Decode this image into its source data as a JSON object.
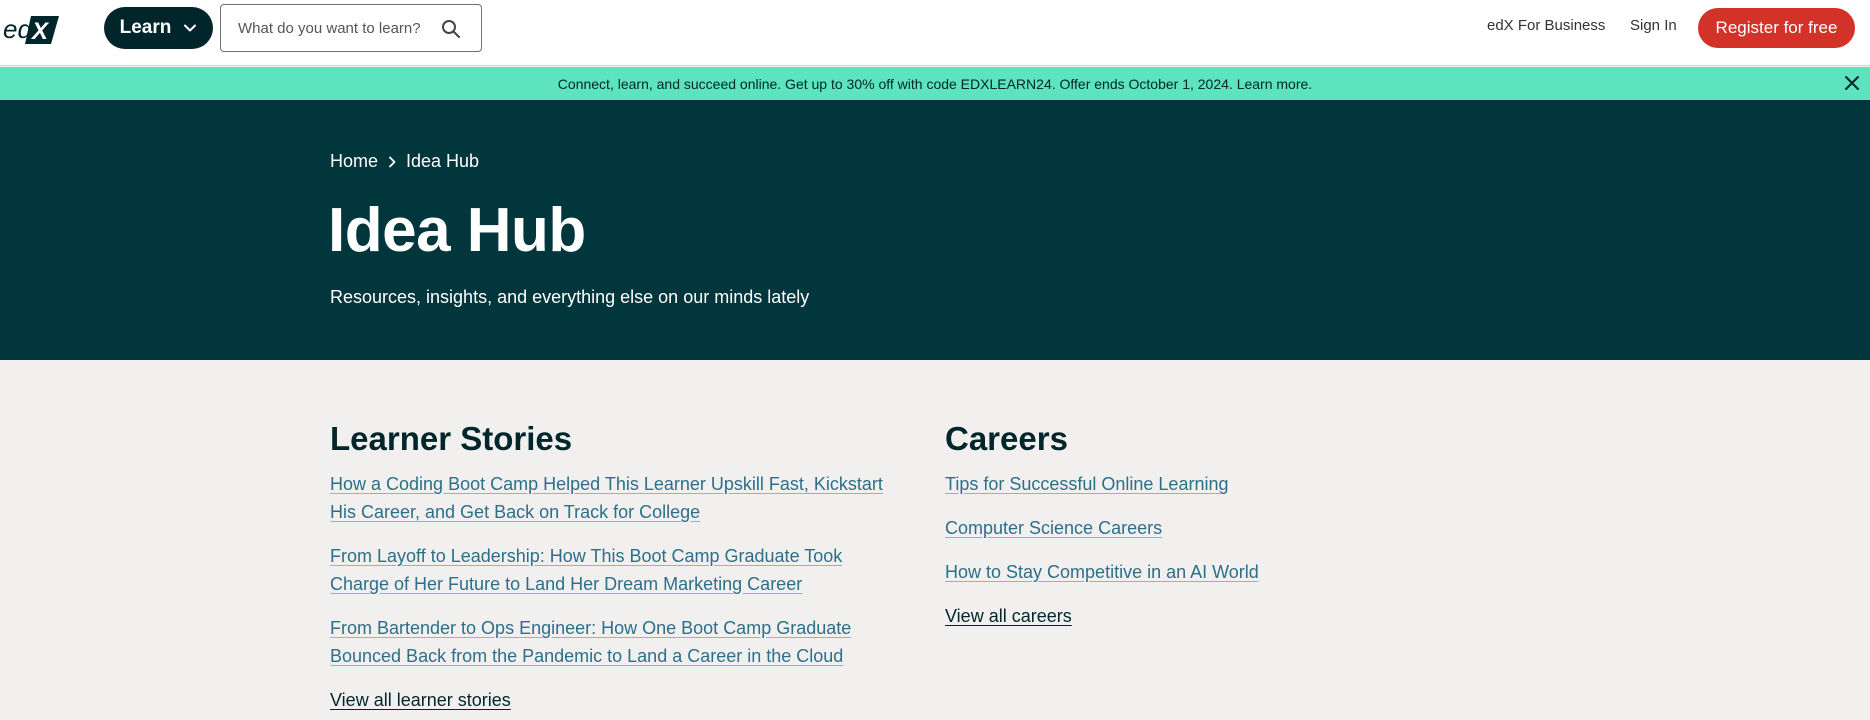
{
  "header": {
    "logo_text": "edX",
    "learn_label": "Learn",
    "search_placeholder": "What do you want to learn?",
    "business_label": "edX For Business",
    "signin_label": "Sign In",
    "register_label": "Register for free"
  },
  "promo": {
    "text": "Connect, learn, and succeed online. Get up to 30% off with code EDXLEARN24. Offer ends October 1, 2024.",
    "link_label": "Learn more."
  },
  "hero": {
    "breadcrumb_home": "Home",
    "breadcrumb_current": "Idea Hub",
    "title": "Idea Hub",
    "subtitle": "Resources, insights, and everything else on our minds lately"
  },
  "learner_stories": {
    "title": "Learner Stories",
    "links": [
      "How a Coding Boot Camp Helped This Learner Upskill Fast, Kickstart His Career, and Get Back on Track for College",
      "From Layoff to Leadership: How This Boot Camp Graduate Took Charge of Her Future to Land Her Dream Marketing Career",
      "From Bartender to Ops Engineer: How One Boot Camp Graduate Bounced Back from the Pandemic to Land a Career in the Cloud"
    ],
    "view_all": "View all learner stories"
  },
  "careers": {
    "title": "Careers",
    "links": [
      "Tips for Successful Online Learning",
      "Computer Science Careers",
      "How to Stay Competitive in an AI World"
    ],
    "view_all": "View all careers"
  },
  "colors": {
    "brand_dark": "#00262b",
    "hero_bg": "#02363d",
    "promo_bg": "#5de3bd",
    "register_bg": "#d23228",
    "link": "#2b6f89"
  }
}
